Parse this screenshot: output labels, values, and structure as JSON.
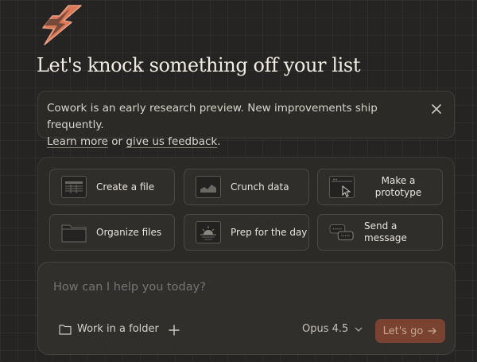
{
  "headline": "Let's knock something off your list",
  "notice": {
    "text": "Cowork is an early research preview. New improvements ship frequently.",
    "learn_more": "Learn more",
    "or": " or ",
    "feedback": "give us feedback",
    "period": "."
  },
  "tasks": [
    {
      "label": "Create a file",
      "icon": "spreadsheet-icon"
    },
    {
      "label": "Crunch data",
      "icon": "chart-icon"
    },
    {
      "label": "Make a prototype",
      "icon": "browser-window-icon"
    },
    {
      "label": "Organize files",
      "icon": "folder-icon"
    },
    {
      "label": "Prep for the day",
      "icon": "sunrise-icon"
    },
    {
      "label": "Send a message",
      "icon": "chat-bubbles-icon"
    }
  ],
  "composer": {
    "placeholder": "How can I help you today?",
    "folder_label": "Work in a folder",
    "model": "Opus 4.5",
    "go_label": "Let's go"
  },
  "colors": {
    "accent": "#d97757",
    "background": "#252422",
    "go_button": "#7a4230"
  }
}
